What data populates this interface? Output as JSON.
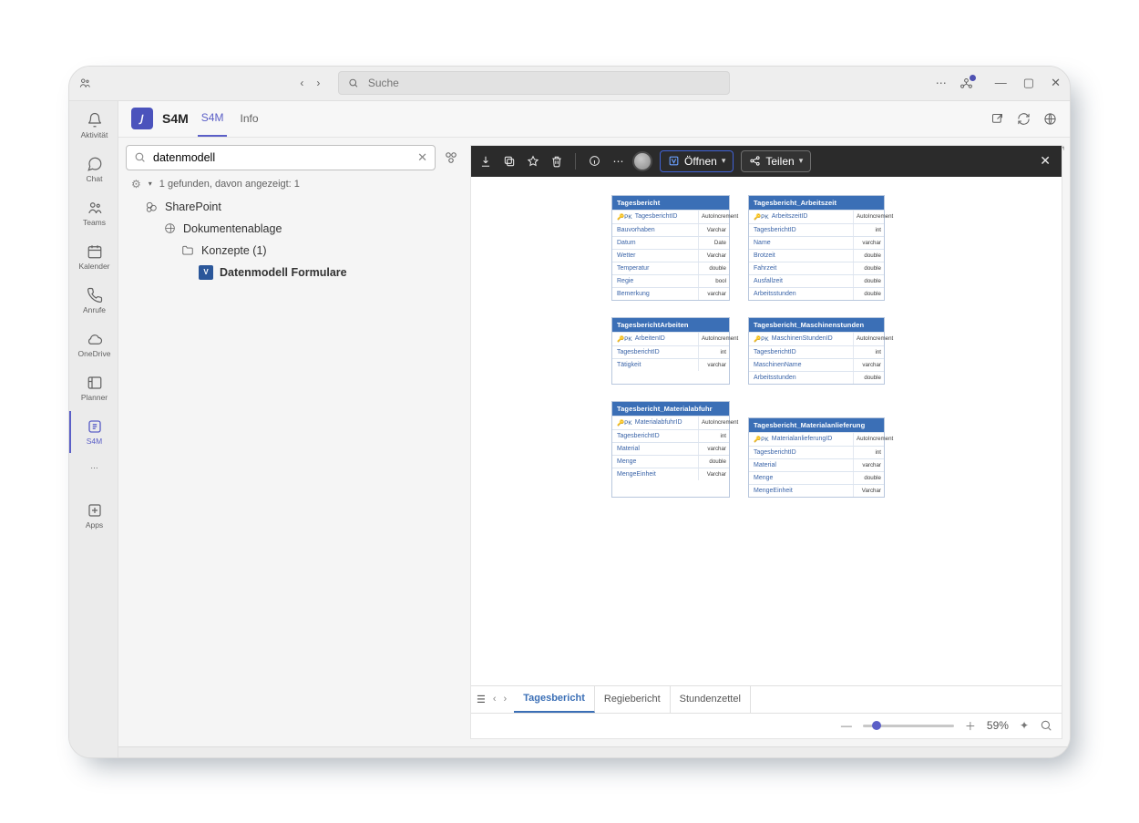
{
  "titlebar": {
    "search_placeholder": "Suche"
  },
  "rail": {
    "items": [
      {
        "key": "activity",
        "label": "Aktivität"
      },
      {
        "key": "chat",
        "label": "Chat"
      },
      {
        "key": "teams",
        "label": "Teams"
      },
      {
        "key": "calendar",
        "label": "Kalender"
      },
      {
        "key": "calls",
        "label": "Anrufe"
      },
      {
        "key": "onedrive",
        "label": "OneDrive"
      },
      {
        "key": "planner",
        "label": "Planner"
      },
      {
        "key": "s4m",
        "label": "S4M"
      },
      {
        "key": "more",
        "label": ""
      },
      {
        "key": "apps",
        "label": "Apps"
      }
    ]
  },
  "header": {
    "app_letter": "𝘑",
    "app_name": "S4M",
    "tabs": [
      {
        "key": "s4m",
        "label": "S4M",
        "active": true
      },
      {
        "key": "info",
        "label": "Info",
        "active": false
      }
    ]
  },
  "search": {
    "value": "datenmodell",
    "result_line": "1 gefunden, davon angezeigt: 1"
  },
  "tree": {
    "root_label": "SharePoint",
    "level1_label": "Dokumentenablage",
    "level2_label": "Konzepte (1)",
    "file_label": "Datenmodell Formulare"
  },
  "preview": {
    "open_label": "Öffnen",
    "share_label": "Teilen",
    "sheets": [
      "Tagesbericht",
      "Regiebericht",
      "Stundenzettel"
    ],
    "active_sheet": 0,
    "zoom_label": "59%"
  },
  "er": {
    "tables": [
      {
        "title": "Tagesbericht",
        "rows": [
          {
            "pk": true,
            "name": "TagesberichtID",
            "type": "AutoIncrement"
          },
          {
            "name": "Bauvorhaben",
            "type": "Varchar"
          },
          {
            "name": "Datum",
            "type": "Date"
          },
          {
            "name": "Wetter",
            "type": "Varchar"
          },
          {
            "name": "Temperatur",
            "type": "double"
          },
          {
            "name": "Regie",
            "type": "bool"
          },
          {
            "name": "Bemerkung",
            "type": "varchar"
          }
        ]
      },
      {
        "title": "Tagesbericht_Arbeitszeit",
        "rows": [
          {
            "pk": true,
            "name": "ArbeitszeitID",
            "type": "AutoIncrement"
          },
          {
            "name": "TagesberichtID",
            "type": "int"
          },
          {
            "name": "Name",
            "type": "varchar"
          },
          {
            "name": "Brotzeit",
            "type": "double"
          },
          {
            "name": "Fahrzeit",
            "type": "double"
          },
          {
            "name": "Ausfallzeit",
            "type": "double"
          },
          {
            "name": "Arbeitsstunden",
            "type": "double"
          }
        ]
      },
      {
        "title": "TagesberichtArbeiten",
        "rows": [
          {
            "pk": true,
            "name": "ArbeitenID",
            "type": "AutoIncrement"
          },
          {
            "name": "TagesberichtID",
            "type": "int"
          },
          {
            "name": "Tätigkeit",
            "type": "varchar"
          }
        ]
      },
      {
        "title": "Tagesbericht_Maschinenstunden",
        "rows": [
          {
            "pk": true,
            "name": "MaschinenStundenID",
            "type": "AutoIncrement"
          },
          {
            "name": "TagesberichtID",
            "type": "int"
          },
          {
            "name": "MaschinenName",
            "type": "varchar"
          },
          {
            "name": "Arbeitsstunden",
            "type": "double"
          }
        ]
      },
      {
        "title": "Tagesbericht_Materialabfuhr",
        "rows": [
          {
            "pk": true,
            "name": "MaterialabfuhrID",
            "type": "AutoIncrement"
          },
          {
            "name": "TagesberichtID",
            "type": "int"
          },
          {
            "name": "Material",
            "type": "varchar"
          },
          {
            "name": "Menge",
            "type": "double"
          },
          {
            "name": "MengeEinheit",
            "type": "Varchar"
          }
        ]
      },
      {
        "title": "Tagesbericht_Materialanlieferung",
        "rows": [
          {
            "pk": true,
            "name": "MaterialanlieferungID",
            "type": "AutoIncrement"
          },
          {
            "name": "TagesberichtID",
            "type": "int"
          },
          {
            "name": "Material",
            "type": "varchar"
          },
          {
            "name": "Menge",
            "type": "double"
          },
          {
            "name": "MengeEinheit",
            "type": "Varchar"
          }
        ]
      }
    ]
  }
}
